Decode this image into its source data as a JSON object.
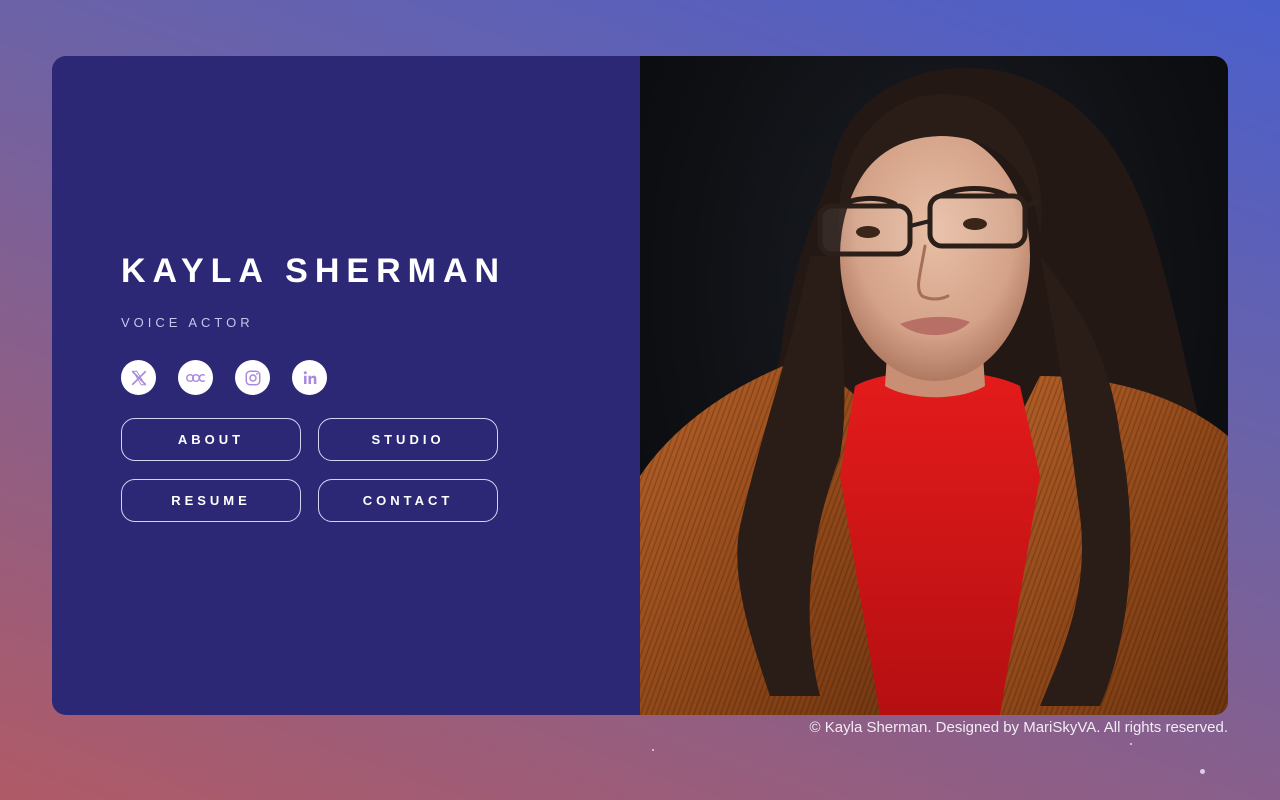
{
  "profile": {
    "name": "KAYLA SHERMAN",
    "subtitle": "VOICE ACTOR"
  },
  "socials": [
    {
      "icon": "x-twitter-icon"
    },
    {
      "icon": "casting-call-club-icon"
    },
    {
      "icon": "instagram-icon"
    },
    {
      "icon": "linkedin-icon"
    }
  ],
  "nav": {
    "about": "ABOUT",
    "studio": "STUDIO",
    "resume": "RESUME",
    "contact": "CONTACT"
  },
  "footer": {
    "text": "© Kayla Sherman. Designed by MariSkyVA. All rights reserved."
  },
  "colors": {
    "panel": "#2c2875",
    "accent_icon": "#a98bdc",
    "text": "#ffffff"
  }
}
